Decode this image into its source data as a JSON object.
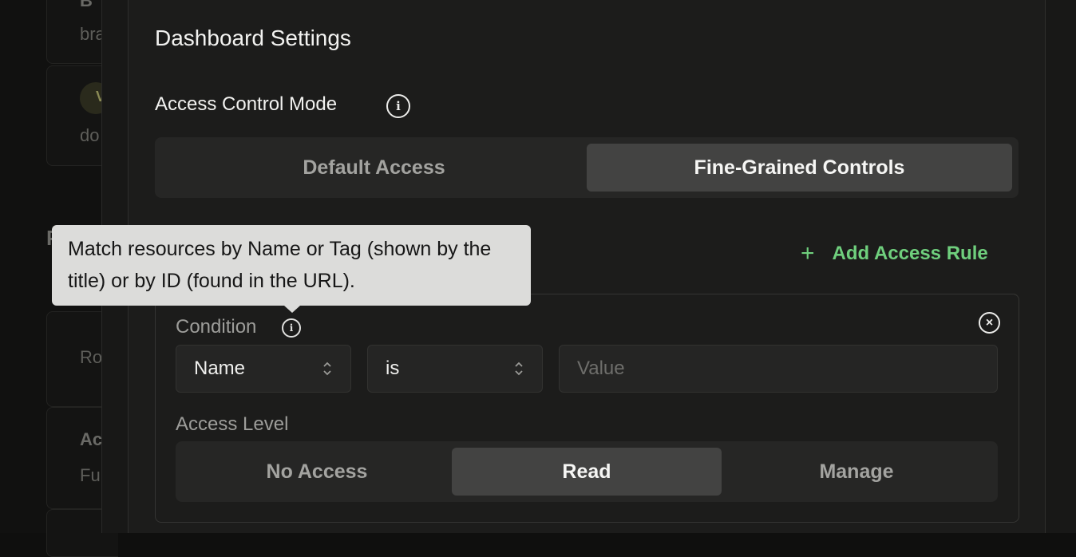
{
  "background": {
    "card1_title": "B",
    "card1_sub": "bra",
    "card1_badge": "V",
    "card1_sub2": "do",
    "section_letter": "P",
    "card2_text": "Ro",
    "card3_title": "Ac",
    "card3_sub": "Fu"
  },
  "panel": {
    "title": "Dashboard Settings",
    "access_control": {
      "label": "Access Control Mode",
      "options": [
        "Default Access",
        "Fine-Grained Controls"
      ],
      "selected": "Fine-Grained Controls"
    },
    "add_rule_label": "Add Access Rule",
    "rule": {
      "condition_label": "Condition",
      "field_select": "Name",
      "operator_select": "is",
      "value_placeholder": "Value",
      "access_level_label": "Access Level",
      "access_levels": [
        "No Access",
        "Read",
        "Manage"
      ],
      "selected_level": "Read"
    }
  },
  "tooltip": {
    "text": "Match resources by Name or Tag (shown by the title) or by ID (found in the URL)."
  },
  "colors": {
    "accent_green": "#6fcf7d",
    "panel_bg": "#1c1c1b",
    "active_segment": "#434342",
    "tooltip_bg": "#dcdcda"
  },
  "icons": [
    "info-icon",
    "plus-icon",
    "close-circle-icon",
    "chevron-updown-icon"
  ]
}
